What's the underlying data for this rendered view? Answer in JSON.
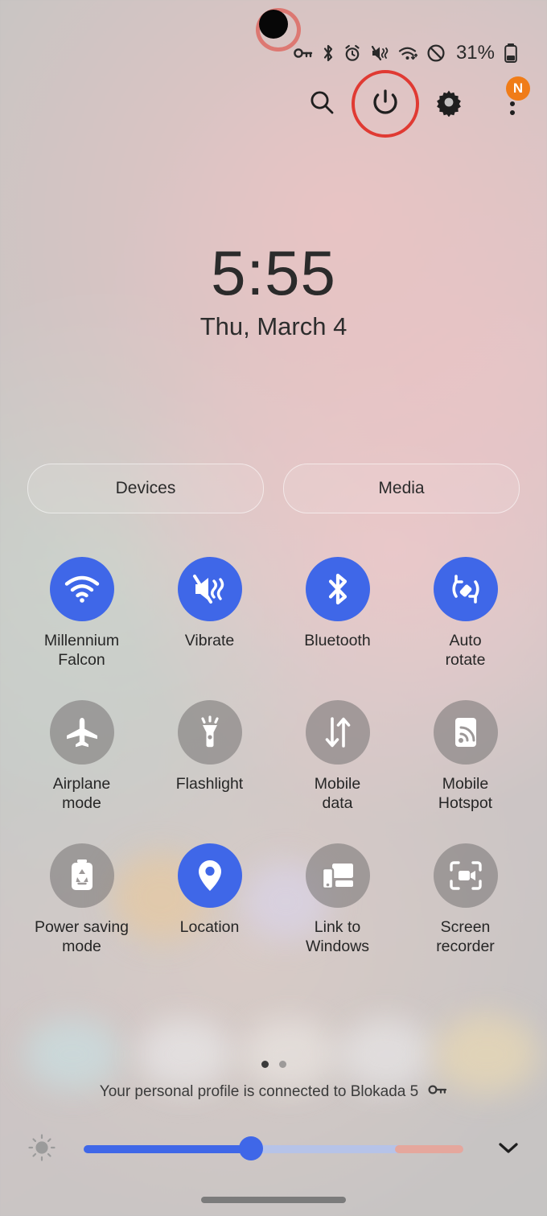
{
  "statusbar": {
    "icons": [
      "vpn-key-icon",
      "bluetooth-icon",
      "alarm-icon",
      "mute-vibrate-icon",
      "wifi-transfer-icon",
      "do-not-disturb-icon"
    ],
    "battery_percent": "31%",
    "battery_icon": "battery-icon"
  },
  "header": {
    "search_icon": "search-icon",
    "power_icon": "power-icon",
    "settings_icon": "gear-icon",
    "menu_icon": "three-dot-menu-icon",
    "menu_badge": "N",
    "annotation_color": "#e03a33",
    "badge_color": "#f07c18"
  },
  "clock": {
    "time": "5:55",
    "date": "Thu, March 4"
  },
  "shortcuts": [
    {
      "label": "Devices",
      "name": "devices-button"
    },
    {
      "label": "Media",
      "name": "media-button"
    }
  ],
  "tiles": [
    [
      {
        "label": "Millennium\nFalcon",
        "icon": "wifi-icon",
        "state": "on",
        "name": "tile-wifi"
      },
      {
        "label": "Vibrate",
        "icon": "vibrate-icon",
        "state": "on",
        "name": "tile-vibrate"
      },
      {
        "label": "Bluetooth",
        "icon": "bluetooth-icon",
        "state": "on",
        "name": "tile-bluetooth"
      },
      {
        "label": "Auto\nrotate",
        "icon": "auto-rotate-icon",
        "state": "on",
        "name": "tile-auto-rotate"
      }
    ],
    [
      {
        "label": "Airplane\nmode",
        "icon": "airplane-icon",
        "state": "off",
        "name": "tile-airplane-mode"
      },
      {
        "label": "Flashlight",
        "icon": "flashlight-icon",
        "state": "off",
        "name": "tile-flashlight"
      },
      {
        "label": "Mobile\ndata",
        "icon": "mobile-data-icon",
        "state": "off",
        "name": "tile-mobile-data"
      },
      {
        "label": "Mobile\nHotspot",
        "icon": "hotspot-icon",
        "state": "off",
        "name": "tile-mobile-hotspot"
      }
    ],
    [
      {
        "label": "Power saving\nmode",
        "icon": "power-saving-icon",
        "state": "off",
        "name": "tile-power-saving-mode"
      },
      {
        "label": "Location",
        "icon": "location-pin-icon",
        "state": "on",
        "name": "tile-location"
      },
      {
        "label": "Link to\nWindows",
        "icon": "link-to-windows-icon",
        "state": "off",
        "name": "tile-link-to-windows"
      },
      {
        "label": "Screen\nrecorder",
        "icon": "screen-recorder-icon",
        "state": "off",
        "name": "tile-screen-recorder"
      }
    ]
  ],
  "pager": {
    "total": 2,
    "active": 1
  },
  "vpn": {
    "text": "Your personal profile is connected to Blokada 5",
    "icon": "vpn-key-icon"
  },
  "brightness": {
    "icon": "brightness-sun-icon",
    "value_percent": 44,
    "expand_icon": "chevron-down-icon",
    "accent_color": "#3f67e8",
    "track_color": "#b6c3e8",
    "warm_color": "#e5a79d"
  },
  "navigation": {
    "home_bar": "home-gesture-bar"
  }
}
